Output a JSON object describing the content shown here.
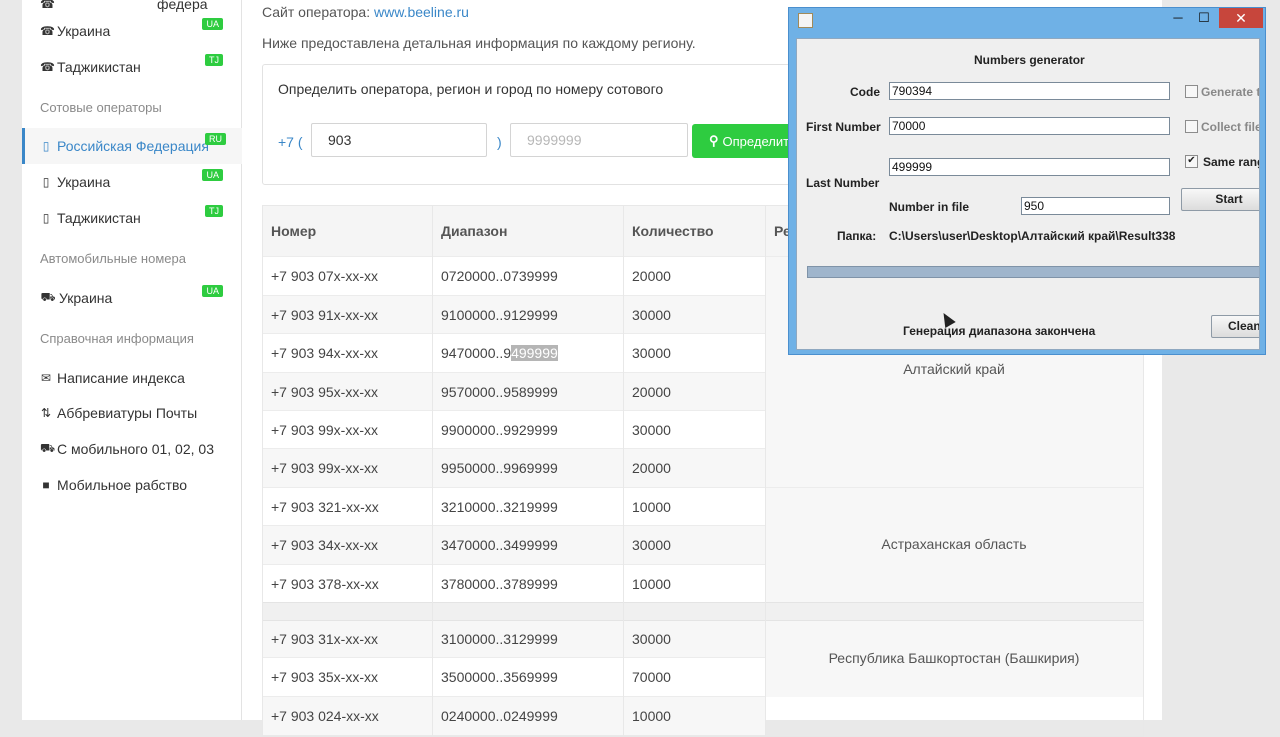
{
  "sidebar": {
    "top_partial": "федера",
    "phone_items": [
      {
        "label": "Украина",
        "badge": "UA"
      },
      {
        "label": "Таджикистан",
        "badge": "TJ"
      }
    ],
    "section_mobile": "Сотовые операторы",
    "mobile_items": [
      {
        "label": "Российская Федерация",
        "badge": "RU"
      },
      {
        "label": "Украина",
        "badge": "UA"
      },
      {
        "label": "Таджикистан",
        "badge": "TJ"
      }
    ],
    "section_auto": "Автомобильные номера",
    "auto_items": [
      {
        "label": "Украина",
        "badge": "UA"
      }
    ],
    "section_ref": "Справочная информация",
    "ref_items": [
      {
        "label": "Написание индекса",
        "icon": "envelope-icon"
      },
      {
        "label": "Аббревиатуры Почты",
        "icon": "sort-icon"
      },
      {
        "label": "С мобильного 01, 02, 03",
        "icon": "ambulance-icon"
      },
      {
        "label": "Мобильное рабство",
        "icon": "lock-icon"
      }
    ]
  },
  "main": {
    "operator_site_label": "Сайт оператора: ",
    "operator_site_link": "www.beeline.ru",
    "info_line": "Ниже предоставлена детальная информация по каждому региону.",
    "search": {
      "title": "Определить оператора, регион и город по номеру сотового",
      "prefix": "+7 (",
      "code_value": "903",
      "paren_close": ")",
      "number_placeholder": "9999999",
      "button_label": "Определить"
    },
    "table": {
      "headers": [
        "Номер",
        "Диапазон",
        "Количество",
        "Ре"
      ],
      "rows": [
        {
          "number": "+7 903 07x-xx-xx",
          "range": "0720000..0739999",
          "count": "20000"
        },
        {
          "number": "+7 903 91x-xx-xx",
          "range": "9100000..9129999",
          "count": "30000"
        },
        {
          "number": "+7 903 94x-xx-xx",
          "range_start": "9470000..9",
          "range_sel": "499999",
          "count": "30000"
        },
        {
          "number": "+7 903 95x-xx-xx",
          "range": "9570000..9589999",
          "count": "20000"
        },
        {
          "number": "+7 903 99x-xx-xx",
          "range": "9900000..9929999",
          "count": "30000"
        },
        {
          "number": "+7 903 99x-xx-xx",
          "range": "9950000..9969999",
          "count": "20000"
        },
        {
          "number": "+7 903 321-xx-xx",
          "range": "3210000..3219999",
          "count": "10000"
        },
        {
          "number": "+7 903 34x-xx-xx",
          "range": "3470000..3499999",
          "count": "30000"
        },
        {
          "number": "+7 903 378-xx-xx",
          "range": "3780000..3789999",
          "count": "10000"
        },
        {
          "number": "+7 903 31x-xx-xx",
          "range": "3100000..3129999",
          "count": "30000"
        },
        {
          "number": "+7 903 35x-xx-xx",
          "range": "3500000..3569999",
          "count": "70000"
        },
        {
          "number": "+7 903 024-xx-xx",
          "range": "0240000..0249999",
          "count": "10000"
        }
      ],
      "regions": [
        "Алтайский край",
        "Астраханская область",
        "Республика Башкортостан (Башкирия)"
      ]
    }
  },
  "dialog": {
    "title_buttons": {
      "minimize": "─",
      "maximize": "☐",
      "close": "✕"
    },
    "heading": "Numbers generator",
    "code_label": "Code",
    "code_value": "790394",
    "first_label": "First Number",
    "first_value": "70000",
    "last_label": "Last Number",
    "last_value": "499999",
    "per_file_label": "Number in file",
    "per_file_value": "950",
    "folder_label": "Папка:",
    "folder_value": "C:\\Users\\user\\Desktop\\Алтайский край\\Result338",
    "opt_generate": "Generate t",
    "opt_collect": "Collect file",
    "opt_same": "Same rang",
    "start_label": "Start",
    "clean_label": "Clean",
    "status": "Генерация диапазона закончена",
    "progress": 1.0
  }
}
